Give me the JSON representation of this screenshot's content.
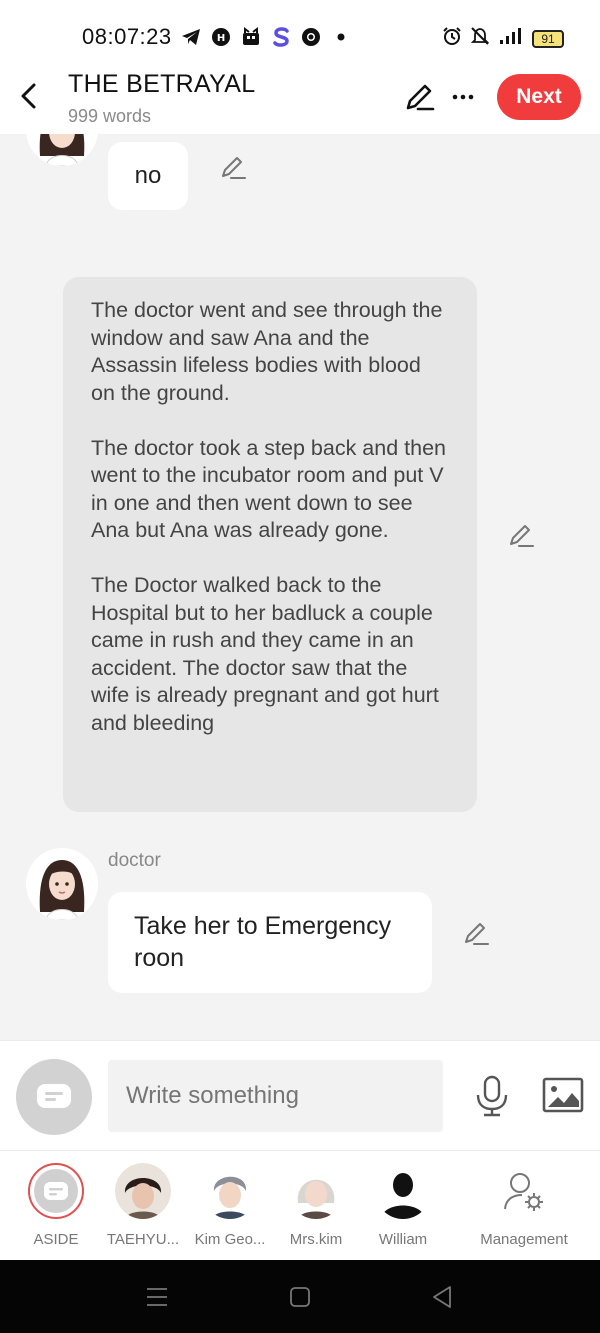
{
  "status": {
    "time": "08:07:23",
    "battery": "91",
    "left_icons": [
      "telegram-icon",
      "hi-icon",
      "gift-icon",
      "s-icon",
      "chrome-icon",
      "dot-icon"
    ],
    "right_icons": [
      "alarm-icon",
      "mute-icon",
      "signal-icon",
      "battery-icon"
    ]
  },
  "header": {
    "title": "THE BETRAYAL",
    "subtitle": "999 words",
    "next_label": "Next"
  },
  "messages": [
    {
      "type": "dialogue",
      "speaker": "",
      "text": "no"
    },
    {
      "type": "narration",
      "text": "The doctor went and see through the window and saw Ana and the Assassin lifeless bodies with blood on the ground.\n\nThe doctor took a step back and then went to the incubator room and put V in one and then went down to see Ana but Ana was already gone.\n\nThe Doctor walked back to the Hospital but to her badluck a couple came in rush and they came in an accident. The doctor saw that the wife is already pregnant and got hurt and bleeding"
    },
    {
      "type": "dialogue",
      "speaker": "doctor",
      "text": "Take her to Emergency roon"
    }
  ],
  "composer": {
    "placeholder": "Write something"
  },
  "characters": [
    {
      "label": "ASIDE"
    },
    {
      "label": "TAEHYU..."
    },
    {
      "label": "Kim Geo..."
    },
    {
      "label": "Mrs.kim"
    },
    {
      "label": "William"
    },
    {
      "label": "Management"
    }
  ],
  "colors": {
    "accent": "#f03c3c",
    "chat_bg": "#f3f3f3",
    "narration_bg": "#e6e6e6"
  }
}
